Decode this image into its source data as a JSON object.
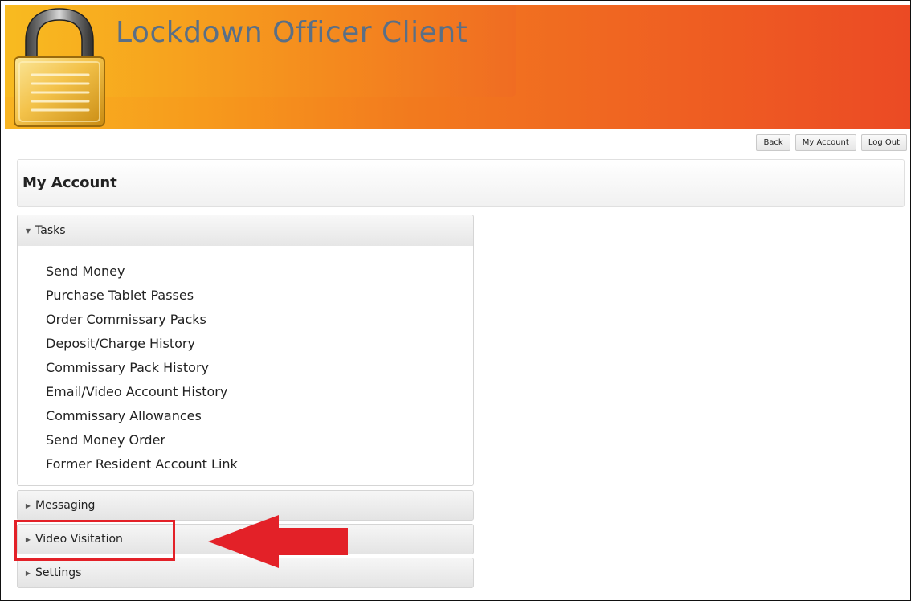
{
  "header": {
    "app_title": "Lockdown Officer Client",
    "logo_icon": "padlock-icon"
  },
  "nav": {
    "back_label": "Back",
    "my_account_label": "My Account",
    "logout_label": "Log Out"
  },
  "page": {
    "title": "My Account"
  },
  "accordion": {
    "tasks": {
      "label": "Tasks",
      "expanded": true,
      "items": [
        "Send Money",
        "Purchase Tablet Passes",
        "Order Commissary Packs",
        "Deposit/Charge History",
        "Commissary Pack History",
        "Email/Video Account History",
        "Commissary Allowances",
        "Send Money Order",
        "Former Resident Account Link"
      ]
    },
    "messaging": {
      "label": "Messaging",
      "expanded": false
    },
    "video_visitation": {
      "label": "Video Visitation",
      "expanded": false
    },
    "settings": {
      "label": "Settings",
      "expanded": false
    }
  },
  "annotation": {
    "highlight_color": "#e32128",
    "target": "Video Visitation",
    "arrow_icon": "left-arrow-icon"
  },
  "colors": {
    "banner_gradient_start": "#f8b421",
    "banner_gradient_end": "#eb4a24",
    "title_text": "#5a6f86"
  }
}
